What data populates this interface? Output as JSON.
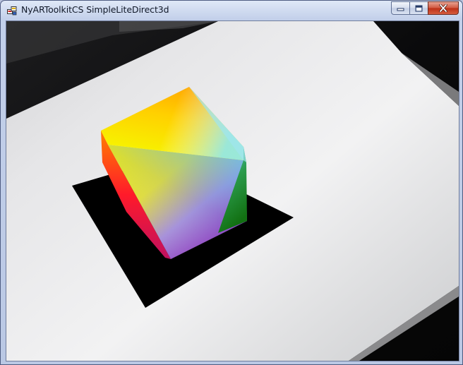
{
  "window": {
    "title": "NyARToolkitCS SimpleLiteDirect3d",
    "icons": {
      "app": "app-window-icon",
      "minimize": "minimize-icon",
      "maximize": "maximize-icon",
      "close": "close-icon"
    }
  },
  "scene": {
    "description_icon": "camera-feed-icon",
    "colors": {
      "paper": "#eeeeee",
      "marker": "#000000",
      "background": "#0b0b0c",
      "cube_top_a": "#ffb000",
      "cube_top_b": "#80e0d0",
      "cube_left": "#ff1020",
      "cube_right": "#208020"
    }
  }
}
